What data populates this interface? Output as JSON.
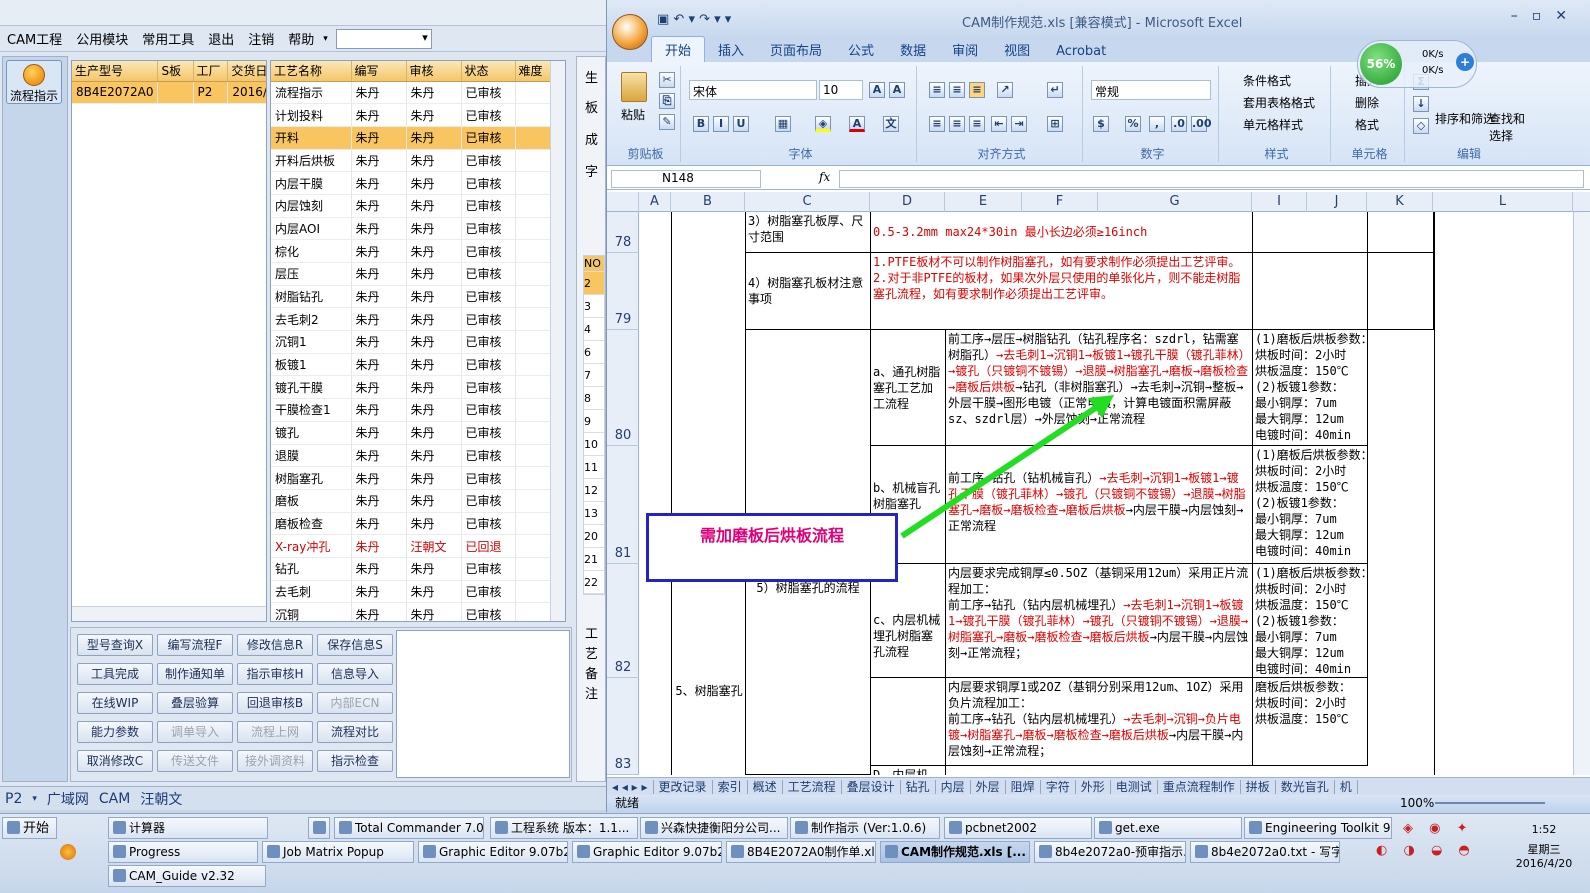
{
  "cam": {
    "menu": [
      "CAM工程",
      "公用模块",
      "常用工具",
      "退出",
      "注销",
      "帮助"
    ],
    "flow_btn": "流程指示",
    "grid1": {
      "headers": [
        "生产型号",
        "S板",
        "工厂",
        "交货日"
      ],
      "rows": [
        [
          "8B4E2072A0",
          "",
          "P2",
          "2016/"
        ]
      ]
    },
    "grid2": {
      "headers": [
        "工艺名称",
        "编写",
        "审核",
        "状态",
        "难度"
      ],
      "rows": [
        [
          "流程指示",
          "朱丹",
          "朱丹",
          "已审核"
        ],
        [
          "计划投料",
          "朱丹",
          "朱丹",
          "已审核"
        ],
        [
          "开料",
          "朱丹",
          "朱丹",
          "已审核"
        ],
        [
          "开料后烘板",
          "朱丹",
          "朱丹",
          "已审核"
        ],
        [
          "内层干膜",
          "朱丹",
          "朱丹",
          "已审核"
        ],
        [
          "内层蚀刻",
          "朱丹",
          "朱丹",
          "已审核"
        ],
        [
          "内层AOI",
          "朱丹",
          "朱丹",
          "已审核"
        ],
        [
          "棕化",
          "朱丹",
          "朱丹",
          "已审核"
        ],
        [
          "层压",
          "朱丹",
          "朱丹",
          "已审核"
        ],
        [
          "树脂钻孔",
          "朱丹",
          "朱丹",
          "已审核"
        ],
        [
          "去毛刺2",
          "朱丹",
          "朱丹",
          "已审核"
        ],
        [
          "沉铜1",
          "朱丹",
          "朱丹",
          "已审核"
        ],
        [
          "板镀1",
          "朱丹",
          "朱丹",
          "已审核"
        ],
        [
          "镀孔干膜",
          "朱丹",
          "朱丹",
          "已审核"
        ],
        [
          "干膜检查1",
          "朱丹",
          "朱丹",
          "已审核"
        ],
        [
          "镀孔",
          "朱丹",
          "朱丹",
          "已审核"
        ],
        [
          "退膜",
          "朱丹",
          "朱丹",
          "已审核"
        ],
        [
          "树脂塞孔",
          "朱丹",
          "朱丹",
          "已审核"
        ],
        [
          "磨板",
          "朱丹",
          "朱丹",
          "已审核"
        ],
        [
          "磨板检查",
          "朱丹",
          "朱丹",
          "已审核"
        ],
        [
          "X-ray冲孔",
          "朱丹",
          "汪朝文",
          "已回退"
        ],
        [
          "钻孔",
          "朱丹",
          "朱丹",
          "已审核"
        ],
        [
          "去毛刺",
          "朱丹",
          "朱丹",
          "已审核"
        ],
        [
          "沉铜",
          "朱丹",
          "朱丹",
          "已审核"
        ]
      ]
    },
    "buttons": [
      [
        "型号查询X",
        "编写流程F",
        "修改信息R",
        "保存信息S"
      ],
      [
        "工具完成",
        "制作通知单",
        "指示审核H",
        "信息导入"
      ],
      [
        "在线WIP",
        "叠层验算",
        "回退审核B",
        "内部ECN"
      ],
      [
        "能力参数",
        "调单导入",
        "流程上网",
        "流程对比"
      ],
      [
        "取消修改C",
        "传送文件",
        "接外调资料",
        "指示检查"
      ]
    ],
    "disabled": [
      "内部ECN",
      "调单导入",
      "流程上网",
      "传送文件",
      "接外调资料"
    ],
    "right_labels": [
      "生",
      "板",
      "成",
      "字"
    ],
    "right_labels2": [
      "工",
      "艺",
      "备",
      "注"
    ],
    "no_col": [
      "NO",
      "2",
      "3",
      "4",
      "6",
      "7",
      "8",
      "9",
      "10",
      "11",
      "12",
      "13",
      "20",
      "21",
      "22"
    ],
    "bottom_tabs": [
      "P2",
      "广域网",
      "CAM",
      "汪朝文"
    ]
  },
  "excel": {
    "title": "CAM制作规范.xls  [兼容模式] - Microsoft Excel",
    "tabs": [
      "开始",
      "插入",
      "页面布局",
      "公式",
      "数据",
      "审阅",
      "视图",
      "Acrobat"
    ],
    "ribbon": {
      "paste": "粘贴",
      "clipboard": "剪贴板",
      "font": "宋体",
      "size": "10",
      "font_group": "字体",
      "align_group": "对齐方式",
      "numfmt": "常规",
      "number_group": "数字",
      "cond": "条件格式",
      "table": "套用表格格式",
      "cellstyle": "单元格样式",
      "style_group": "样式",
      "insert": "插入",
      "delete": "删除",
      "format": "格式",
      "cells_group": "单元格",
      "sort": "排序和筛选",
      "find": "查找和选择",
      "edit_group": "编辑",
      "percent": "56%",
      "up": "0K/s",
      "down": "0K/s"
    },
    "namebox": "N148",
    "cols": [
      "A",
      "B",
      "C",
      "D",
      "E",
      "F",
      "G",
      "I",
      "J",
      "K",
      "L"
    ],
    "rows": [
      "78",
      "79",
      "80",
      "81",
      "82",
      "83"
    ],
    "cells": {
      "c78": "3）树脂塞孔板厚、尺寸范围",
      "d78": "0.5-3.2mm    max24*30in 最小长边必须≥16inch",
      "c79": "4）树脂塞孔板材注意事项",
      "d79": "1.PTFE板材不可以制作树脂塞孔，如有要求制作必须提出工艺评审。\n2.对于非PTFE的板材，如果次外层只使用的单张化片，则不能走树脂塞孔流程，如有要求制作必须提出工艺评审。",
      "d80": "a、通孔树脂塞孔工艺加工流程",
      "e80a": "前工序→层压→树脂钻孔（钻孔程序名：szdrl，钻需塞树脂孔）",
      "e80b": "→去毛刺1→沉铜1→板镀1→镀孔干膜（镀孔菲林）→镀孔（只镀铜不镀锡）→退膜→树脂塞孔→磨板→磨板检查→磨板后烘板",
      "e80c": "→钻孔（非树脂塞孔）→去毛刺→沉铜→整板→外层干膜→图形电镀（正常电镀，计算电镀面积需屏蔽sz、szdrl层）→外层蚀刻→正常流程",
      "i80": "(1)磨板后烘板参数：\n烘板时间：2小时\n烘板温度：150℃\n(2)板镀1参数：\n最小铜厚：7um\n最大铜厚：12um\n电镀时间：40min",
      "d81": "b、机械盲孔树脂塞孔",
      "e81a": "前工序→钻孔（钻机械盲孔）",
      "e81b": "→去毛刺→沉铜1→板镀1→镀孔干膜（镀孔菲林）→镀孔（只镀铜不镀锡）→退膜→树脂塞孔→磨板→磨板检查→磨板后烘板",
      "e81c": "→内层干膜→内层蚀刻→正常流程",
      "i81": "(1)磨板后烘板参数：\n烘板时间：2小时\n烘板温度：150℃\n(2)板镀1参数：\n最小铜厚：7um\n最大铜厚：12um\n电镀时间：40min",
      "c82": "5）树脂塞孔的流程",
      "d82": "c、内层机械埋孔树脂塞孔流程",
      "e82a": "内层要求完成铜厚≤0.5OZ（基铜采用12um）采用正片流程加工：\n前工序→钻孔（钻内层机械埋孔）",
      "e82b": "→去毛刺1→沉铜1→板镀1→镀孔干膜（镀孔菲林）→镀孔（只镀铜不镀锡）→退膜→树脂塞孔→磨板→磨板检查→磨板后烘板",
      "e82c": "→内层干膜→内层蚀刻→正常流程；",
      "i82": "(1)磨板后烘板参数：\n烘板时间：2小时\n烘板温度：150℃\n(2)板镀1参数：\n最小铜厚：7um\n最大铜厚：12um\n电镀时间：40min",
      "b83": "5、树脂塞孔",
      "e83a": "内层要求铜厚1或2OZ（基铜分别采用12um、1OZ）采用负片流程加工：\n前工序→钻孔（钻内层机械埋孔）",
      "e83b": "→去毛刺→沉铜→负片电镀→树脂塞孔→磨板→磨板检查→磨板后烘板",
      "e83c": "→内层干膜→内层蚀刻→正常流程；",
      "i83": "磨板后烘板参数：\n烘板时间：2小时\n烘板温度：150℃",
      "d84": "D、内层机"
    },
    "sheets": [
      "更改记录",
      "索引",
      "概述",
      "工艺流程",
      "叠层设计",
      "钻孔",
      "内层",
      "外层",
      "阻焊",
      "字符",
      "外形",
      "电测试",
      "重点流程制作",
      "拼板",
      "数光盲孔",
      "机"
    ],
    "status": "就绪",
    "zoom": "100%"
  },
  "callout": "需加磨板后烘板流程",
  "taskbar": {
    "start": "开始",
    "row1": [
      "计算器",
      "",
      "Total Commander 7.0 ...",
      "工程系统  版本：1.1...",
      "兴森快捷衡阳分公司...",
      "制作指示 (Ver:1.0.6)",
      "pcbnet2002",
      "get.exe",
      "Engineering Toolkit 9.0..."
    ],
    "row2": [
      "Progress",
      "Job Matrix Popup",
      "Graphic Editor 9.07b2 (...",
      "Graphic Editor 9.07b2 (...",
      "8B4E2072A0制作单.xls...",
      "CAM制作规范.xls [...",
      "8b4e2072a0-预审指示...",
      "8b4e2072a0.txt - 写字板"
    ],
    "row3": [
      "CAM_Guide v2.32"
    ],
    "time": "1:52",
    "weekday": "星期三",
    "date": "2016/4/20"
  }
}
